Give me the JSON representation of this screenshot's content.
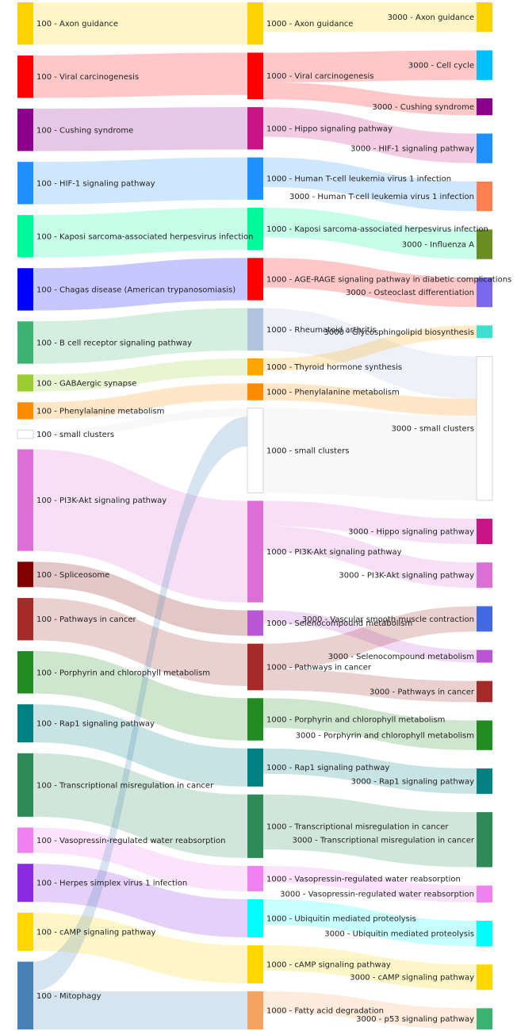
{
  "columns": [
    {
      "nodes": [
        {
          "label": "100 - Axon guidance",
          "color": "#FFD300"
        },
        {
          "label": "100 - Viral carcinogenesis",
          "color": "#FF0000"
        },
        {
          "label": "100 - Cushing syndrome",
          "color": "#8B008B"
        },
        {
          "label": "100 - HIF-1 signaling pathway",
          "color": "#1E90FF"
        },
        {
          "label": "100 - Kaposi sarcoma-associated herpesvirus infection",
          "color": "#00FA9A"
        },
        {
          "label": "100 - Chagas disease (American trypanosomiasis)",
          "color": "#0000FF"
        },
        {
          "label": "100 - B cell receptor signaling pathway",
          "color": "#3CB371"
        },
        {
          "label": "100 - GABAergic synapse",
          "color": "#9ACD32"
        },
        {
          "label": "100 - Phenylalanine metabolism",
          "color": "#FF8C00"
        },
        {
          "label": "100 - small clusters",
          "color": "#FFFFFF"
        },
        {
          "label": "100 - PI3K-Akt signaling pathway",
          "color": "#DA70D6"
        },
        {
          "label": "100 - Spliceosome",
          "color": "#800000"
        },
        {
          "label": "100 - Pathways in cancer",
          "color": "#A52A2A"
        },
        {
          "label": "100 - Porphyrin and chlorophyll metabolism",
          "color": "#228B22"
        },
        {
          "label": "100 - Rap1 signaling pathway",
          "color": "#008080"
        },
        {
          "label": "100 - Transcriptional misregulation in cancer",
          "color": "#2E8B57"
        },
        {
          "label": "100 - Vasopressin-regulated water reabsorption",
          "color": "#EE82EE"
        },
        {
          "label": "100 - Herpes simplex virus 1 infection",
          "color": "#8A2BE2"
        },
        {
          "label": "100 - cAMP signaling pathway",
          "color": "#FFD700"
        },
        {
          "label": "100 - Mitophagy",
          "color": "#4682B4"
        }
      ]
    },
    {
      "nodes": [
        {
          "label": "1000 - Axon guidance",
          "color": "#FFD300"
        },
        {
          "label": "1000 - Viral carcinogenesis",
          "color": "#FF0000"
        },
        {
          "label": "1000 - Hippo signaling pathway",
          "color": "#C71585"
        },
        {
          "label": "1000 - Human T-cell leukemia virus 1 infection",
          "color": "#1E90FF"
        },
        {
          "label": "1000 - Kaposi sarcoma-associated herpesvirus infection",
          "color": "#00FA9A"
        },
        {
          "label": "1000 - AGE-RAGE signaling pathway in diabetic complications",
          "color": "#FF0000"
        },
        {
          "label": "1000 - Rheumatoid arthritis",
          "color": "#B0C4DE"
        },
        {
          "label": "1000 - Thyroid hormone synthesis",
          "color": "#FFA500"
        },
        {
          "label": "1000 - Phenylalanine metabolism",
          "color": "#FF8C00"
        },
        {
          "label": "1000 - small clusters",
          "color": "#FFFFFF"
        },
        {
          "label": "1000 - PI3K-Akt signaling pathway",
          "color": "#DA70D6"
        },
        {
          "label": "1000 - Selenocompound metabolism",
          "color": "#BA55D3"
        },
        {
          "label": "1000 - Pathways in cancer",
          "color": "#A52A2A"
        },
        {
          "label": "1000 - Porphyrin and chlorophyll metabolism",
          "color": "#228B22"
        },
        {
          "label": "1000 - Rap1 signaling pathway",
          "color": "#008080"
        },
        {
          "label": "1000 - Transcriptional misregulation in cancer",
          "color": "#2E8B57"
        },
        {
          "label": "1000 - Vasopressin-regulated water reabsorption",
          "color": "#EE82EE"
        },
        {
          "label": "1000 - Ubiquitin mediated proteolysis",
          "color": "#00FFFF"
        },
        {
          "label": "1000 - cAMP signaling pathway",
          "color": "#FFD700"
        },
        {
          "label": "1000 - Fatty acid degradation",
          "color": "#F4A460"
        }
      ]
    },
    {
      "nodes": [
        {
          "label": "3000 - Axon guidance",
          "color": "#FFD300"
        },
        {
          "label": "3000 - Cell cycle",
          "color": "#00BFFF"
        },
        {
          "label": "3000 - Cushing syndrome",
          "color": "#8B008B"
        },
        {
          "label": "3000 - HIF-1 signaling pathway",
          "color": "#1E90FF"
        },
        {
          "label": "3000 - Human T-cell leukemia virus 1 infection",
          "color": "#FF7F50"
        },
        {
          "label": "3000 - Influenza A",
          "color": "#6B8E23"
        },
        {
          "label": "3000 - Osteoclast differentiation",
          "color": "#7B68EE"
        },
        {
          "label": "3000 - Glycosphingolipid biosynthesis",
          "color": "#40E0D0"
        },
        {
          "label": "3000 - small clusters",
          "color": "#FFFFFF"
        },
        {
          "label": "3000 - Hippo signaling pathway",
          "color": "#C71585"
        },
        {
          "label": "3000 - PI3K-Akt signaling pathway",
          "color": "#DA70D6"
        },
        {
          "label": "3000 - Vascular smooth muscle contraction",
          "color": "#4169E1"
        },
        {
          "label": "3000 - Selenocompound metabolism",
          "color": "#BA55D3"
        },
        {
          "label": "3000 - Pathways in cancer",
          "color": "#A52A2A"
        },
        {
          "label": "3000 - Porphyrin and chlorophyll metabolism",
          "color": "#228B22"
        },
        {
          "label": "3000 - Rap1 signaling pathway",
          "color": "#008080"
        },
        {
          "label": "3000 - Transcriptional misregulation in cancer",
          "color": "#2E8B57"
        },
        {
          "label": "3000 - Vasopressin-regulated water reabsorption",
          "color": "#EE82EE"
        },
        {
          "label": "3000 - Ubiquitin mediated proteolysis",
          "color": "#00FFFF"
        },
        {
          "label": "3000 - cAMP signaling pathway",
          "color": "#FFD700"
        },
        {
          "label": "3000 - p53 signaling pathway",
          "color": "#3CB371"
        }
      ]
    }
  ],
  "links": [
    {
      "from": [
        0,
        0
      ],
      "to": [
        1,
        0
      ],
      "value": 1.0
    },
    {
      "from": [
        0,
        1
      ],
      "to": [
        1,
        1
      ],
      "value": 1.0
    },
    {
      "from": [
        0,
        2
      ],
      "to": [
        1,
        2
      ],
      "value": 1.0
    },
    {
      "from": [
        0,
        3
      ],
      "to": [
        1,
        3
      ],
      "value": 1.0
    },
    {
      "from": [
        0,
        4
      ],
      "to": [
        1,
        4
      ],
      "value": 1.0
    },
    {
      "from": [
        0,
        5
      ],
      "to": [
        1,
        5
      ],
      "value": 1.0
    },
    {
      "from": [
        0,
        6
      ],
      "to": [
        1,
        6
      ],
      "value": 1.0
    },
    {
      "from": [
        0,
        7
      ],
      "to": [
        1,
        7
      ],
      "value": 0.4
    },
    {
      "from": [
        0,
        8
      ],
      "to": [
        1,
        8
      ],
      "value": 0.4
    },
    {
      "from": [
        0,
        9
      ],
      "to": [
        1,
        9
      ],
      "value": 0.2
    },
    {
      "from": [
        0,
        10
      ],
      "to": [
        1,
        10
      ],
      "value": 2.4
    },
    {
      "from": [
        0,
        11
      ],
      "to": [
        1,
        11
      ],
      "value": 0.6
    },
    {
      "from": [
        0,
        12
      ],
      "to": [
        1,
        12
      ],
      "value": 1.0
    },
    {
      "from": [
        0,
        13
      ],
      "to": [
        1,
        13
      ],
      "value": 1.0
    },
    {
      "from": [
        0,
        14
      ],
      "to": [
        1,
        14
      ],
      "value": 0.9
    },
    {
      "from": [
        0,
        15
      ],
      "to": [
        1,
        15
      ],
      "value": 1.5
    },
    {
      "from": [
        0,
        16
      ],
      "to": [
        1,
        16
      ],
      "value": 0.6
    },
    {
      "from": [
        0,
        17
      ],
      "to": [
        1,
        17
      ],
      "value": 0.9
    },
    {
      "from": [
        0,
        18
      ],
      "to": [
        1,
        18
      ],
      "value": 0.9
    },
    {
      "from": [
        0,
        19
      ],
      "to": [
        1,
        19
      ],
      "value": 0.9
    },
    {
      "from": [
        0,
        19
      ],
      "to": [
        1,
        9
      ],
      "value": 0.7
    },
    {
      "from": [
        1,
        0
      ],
      "to": [
        2,
        0
      ],
      "value": 0.7
    },
    {
      "from": [
        1,
        1
      ],
      "to": [
        2,
        1
      ],
      "value": 0.7
    },
    {
      "from": [
        1,
        1
      ],
      "to": [
        2,
        2
      ],
      "value": 0.4
    },
    {
      "from": [
        1,
        2
      ],
      "to": [
        2,
        3
      ],
      "value": 0.7
    },
    {
      "from": [
        1,
        3
      ],
      "to": [
        2,
        4
      ],
      "value": 0.7
    },
    {
      "from": [
        1,
        4
      ],
      "to": [
        2,
        5
      ],
      "value": 0.7
    },
    {
      "from": [
        1,
        5
      ],
      "to": [
        2,
        6
      ],
      "value": 0.7
    },
    {
      "from": [
        1,
        7
      ],
      "to": [
        2,
        7
      ],
      "value": 0.3
    },
    {
      "from": [
        1,
        6
      ],
      "to": [
        2,
        8
      ],
      "value": 1.0
    },
    {
      "from": [
        1,
        8
      ],
      "to": [
        2,
        8
      ],
      "value": 0.4
    },
    {
      "from": [
        1,
        9
      ],
      "to": [
        2,
        8
      ],
      "value": 2.0
    },
    {
      "from": [
        1,
        10
      ],
      "to": [
        2,
        9
      ],
      "value": 0.6
    },
    {
      "from": [
        1,
        10
      ],
      "to": [
        2,
        10
      ],
      "value": 0.6
    },
    {
      "from": [
        1,
        12
      ],
      "to": [
        2,
        11
      ],
      "value": 0.6
    },
    {
      "from": [
        1,
        11
      ],
      "to": [
        2,
        12
      ],
      "value": 0.3
    },
    {
      "from": [
        1,
        12
      ],
      "to": [
        2,
        13
      ],
      "value": 0.5
    },
    {
      "from": [
        1,
        13
      ],
      "to": [
        2,
        14
      ],
      "value": 0.7
    },
    {
      "from": [
        1,
        14
      ],
      "to": [
        2,
        15
      ],
      "value": 0.6
    },
    {
      "from": [
        1,
        15
      ],
      "to": [
        2,
        16
      ],
      "value": 1.3
    },
    {
      "from": [
        1,
        16
      ],
      "to": [
        2,
        17
      ],
      "value": 0.4
    },
    {
      "from": [
        1,
        17
      ],
      "to": [
        2,
        18
      ],
      "value": 0.6
    },
    {
      "from": [
        1,
        18
      ],
      "to": [
        2,
        19
      ],
      "value": 0.6
    },
    {
      "from": [
        1,
        19
      ],
      "to": [
        2,
        20
      ],
      "value": 0.5
    }
  ]
}
